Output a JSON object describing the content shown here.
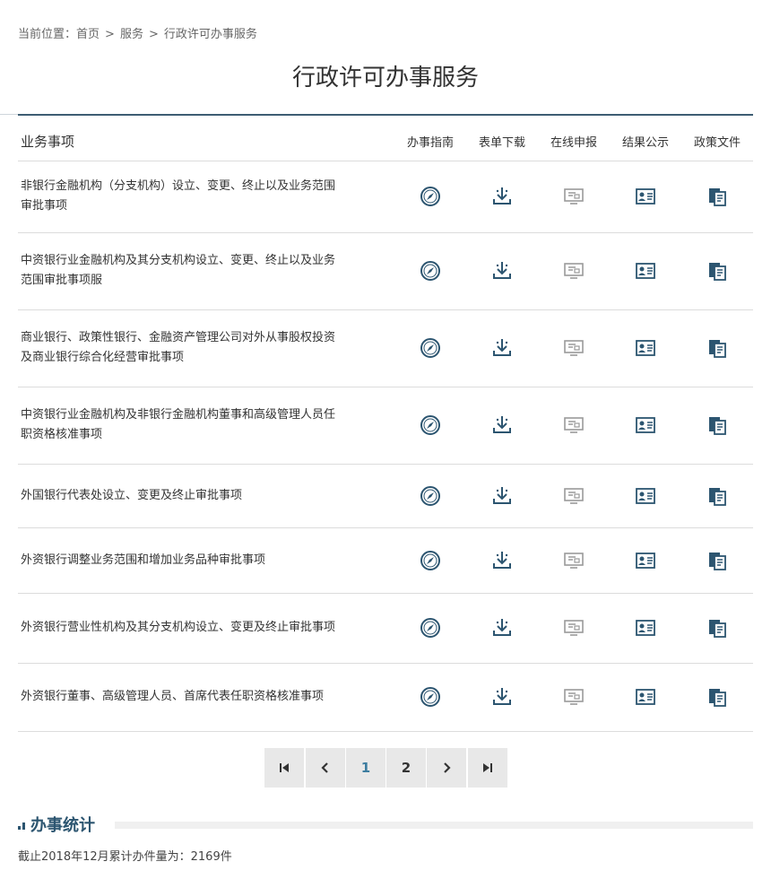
{
  "breadcrumb": {
    "prefix": "当前位置：",
    "items": [
      "首页",
      "服务",
      "行政许可办事服务"
    ],
    "separator": ">"
  },
  "page_title": "行政许可办事服务",
  "table": {
    "headers": [
      "业务事项",
      "办事指南",
      "表单下载",
      "在线申报",
      "结果公示",
      "政策文件"
    ],
    "rows": [
      {
        "name": "非银行金融机构（分支机构）设立、变更、终止以及业务范围审批事项"
      },
      {
        "name": "中资银行业金融机构及其分支机构设立、变更、终止以及业务范围审批事项服"
      },
      {
        "name": "商业银行、政策性银行、金融资产管理公司对外从事股权投资及商业银行综合化经营审批事项"
      },
      {
        "name": "中资银行业金融机构及非银行金融机构董事和高级管理人员任职资格核准事项"
      },
      {
        "name": "外国银行代表处设立、变更及终止审批事项"
      },
      {
        "name": "外资银行调整业务范围和增加业务品种审批事项"
      },
      {
        "name": " 外资银行营业性机构及其分支机构设立、变更及终止审批事项"
      },
      {
        "name": "外资银行董事、高级管理人员、首席代表任职资格核准事项"
      }
    ],
    "icons": [
      "compass-icon",
      "download-icon",
      "monitor-icon",
      "id-card-icon",
      "documents-icon"
    ]
  },
  "pagination": {
    "pages": [
      "1",
      "2"
    ],
    "current": "1"
  },
  "stats": {
    "title": "办事统计",
    "text": "截止2018年12月累计办件量为：2169件"
  },
  "colors": {
    "accent": "#3d5d73",
    "icon_dark": "#2c5570",
    "icon_muted": "#9a9a9a",
    "active_page": "#3d7da0"
  }
}
